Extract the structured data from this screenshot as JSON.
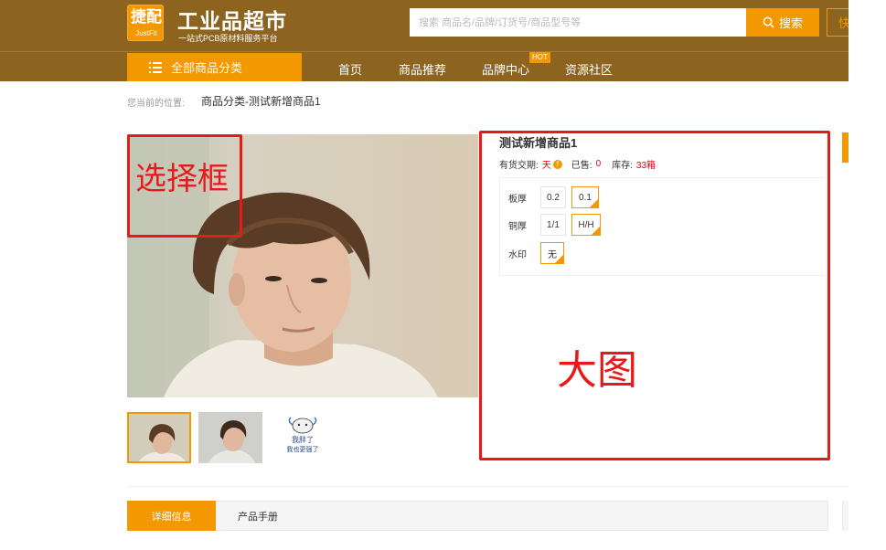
{
  "header": {
    "logo_main": "捷配",
    "logo_sub": "JustFit",
    "site_title": "工业品超市",
    "site_subtitle": "一站式PCB原材料服务平台",
    "search_placeholder": "搜索 商品名/品牌/订货号/商品型号等",
    "search_button": "搜索",
    "quick_button": "快"
  },
  "nav": {
    "all_categories": "全部商品分类",
    "items": [
      {
        "label": "首页"
      },
      {
        "label": "商品推荐"
      },
      {
        "label": "品牌中心",
        "badge": "HOT"
      },
      {
        "label": "资源社区"
      }
    ]
  },
  "breadcrumb": {
    "prefix": "您当前的位置:",
    "current": "商品分类-测试新增商品1"
  },
  "gallery": {
    "thumbnail_text": [
      "我胖了",
      "我也更强了"
    ]
  },
  "product": {
    "title": "测试新增商品1",
    "delivery_label": "有货交期:",
    "delivery_value": "天",
    "sold_label": "已售:",
    "sold_value": "0",
    "stock_label": "库存:",
    "stock_value": "33箱",
    "specs": [
      {
        "label": "板厚",
        "options": [
          {
            "text": "0.2",
            "selected": false
          },
          {
            "text": "0.1",
            "selected": true
          }
        ]
      },
      {
        "label": "铜厚",
        "options": [
          {
            "text": "1/1",
            "selected": false
          },
          {
            "text": "H/H",
            "selected": true
          }
        ]
      },
      {
        "label": "水印",
        "options": [
          {
            "text": "无",
            "selected": true
          }
        ]
      }
    ]
  },
  "annotations": {
    "select_box_label": "选择框",
    "large_image_label": "大图"
  },
  "tabs": [
    {
      "label": "详细信息",
      "active": true
    },
    {
      "label": "产品手册",
      "active": false
    }
  ],
  "colors": {
    "brand_brown": "#8c6420",
    "accent_orange": "#f39800",
    "price_red": "#e60012",
    "annotation_red": "#e8191a"
  }
}
